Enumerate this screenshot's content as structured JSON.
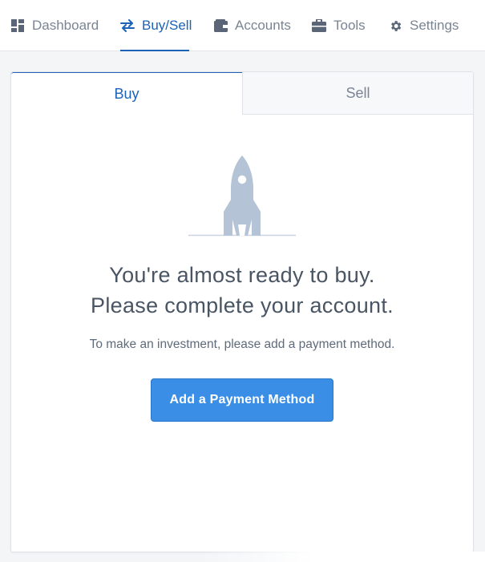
{
  "nav": {
    "items": [
      {
        "label": "Dashboard",
        "icon": "dashboard-grid-icon"
      },
      {
        "label": "Buy/Sell",
        "icon": "swap-arrows-icon"
      },
      {
        "label": "Accounts",
        "icon": "wallet-icon"
      },
      {
        "label": "Tools",
        "icon": "briefcase-icon"
      },
      {
        "label": "Settings",
        "icon": "gear-icon"
      }
    ],
    "active": "Buy/Sell"
  },
  "tabs": {
    "buy": "Buy",
    "sell": "Sell",
    "active": "Buy"
  },
  "empty_state": {
    "illustration": "rocket-icon",
    "headline_line1": "You're almost ready to buy.",
    "headline_line2": "Please complete your account.",
    "subtext": "To make an investment, please add a payment method.",
    "button_label": "Add a Payment Method"
  },
  "colors": {
    "accent": "#1c63b8",
    "button": "#3a8ee6",
    "muted_text": "#7a8594",
    "illustration": "#b5c3d6"
  }
}
